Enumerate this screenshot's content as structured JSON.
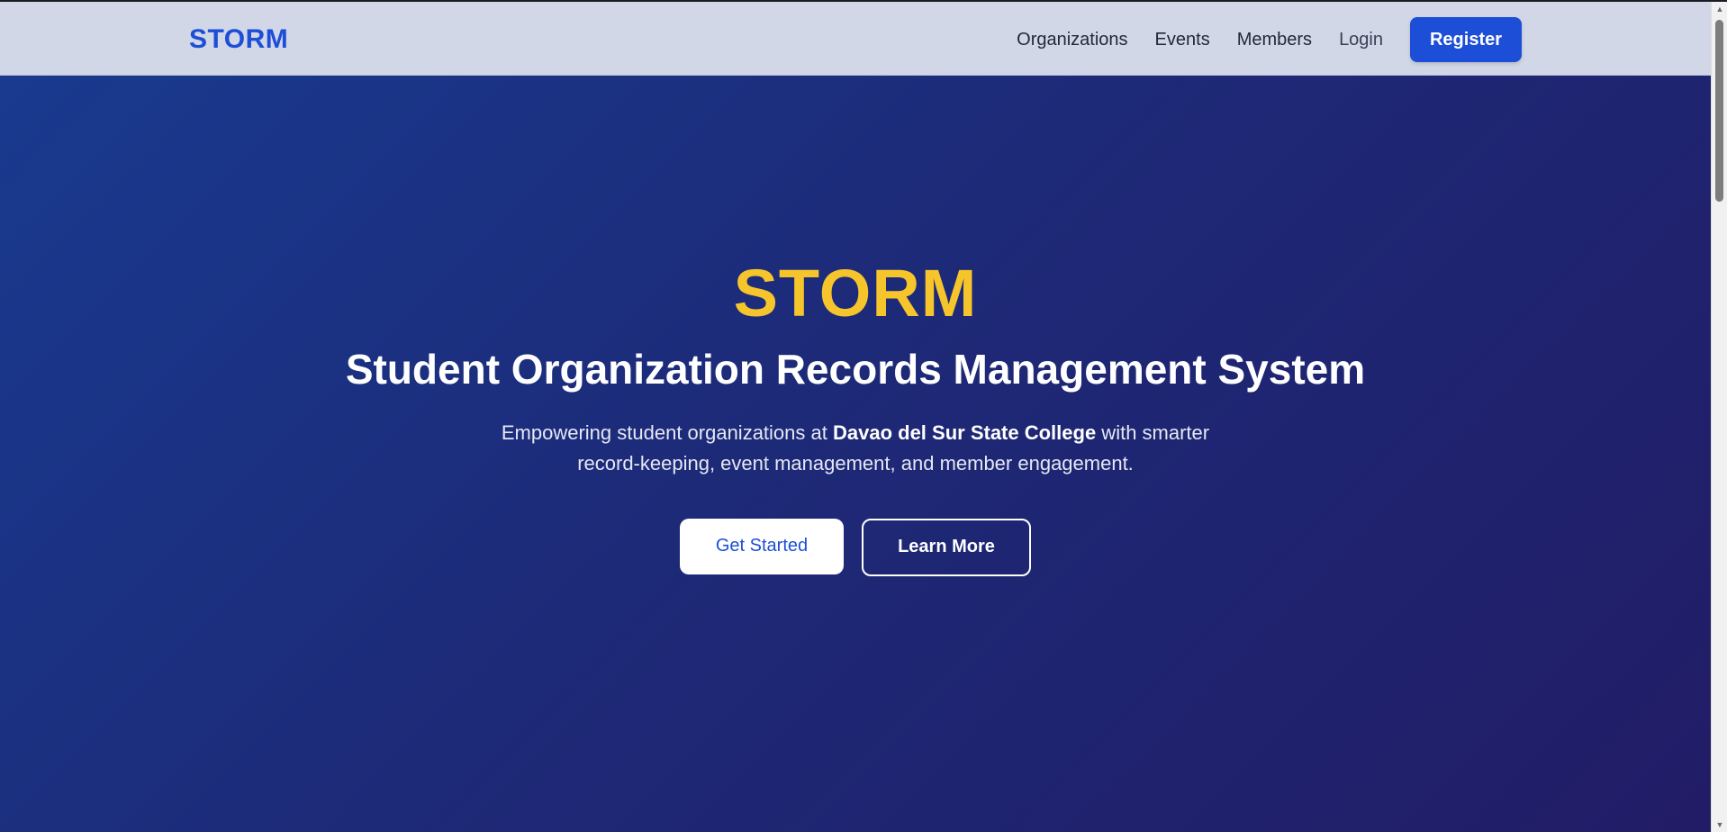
{
  "navbar": {
    "brand": "STORM",
    "links": [
      "Organizations",
      "Events",
      "Members",
      "Login"
    ],
    "register_label": "Register"
  },
  "hero": {
    "title": "STORM",
    "subtitle": "Student Organization Records Management System",
    "desc_prefix": "Empowering student organizations at ",
    "desc_college": "Davao del Sur State College",
    "desc_suffix": " with smarter record-keeping, event management, and member engagement.",
    "primary_button": "Get Started",
    "secondary_button": "Learn More"
  },
  "colors": {
    "brand_blue": "#1d4ed8",
    "accent_yellow": "#f6c52b",
    "hero_gradient_start": "#193a8f",
    "hero_gradient_end": "#221c66"
  },
  "icons": {
    "scroll_up": "scroll-up-arrow-icon",
    "scroll_down": "scroll-down-arrow-icon"
  }
}
